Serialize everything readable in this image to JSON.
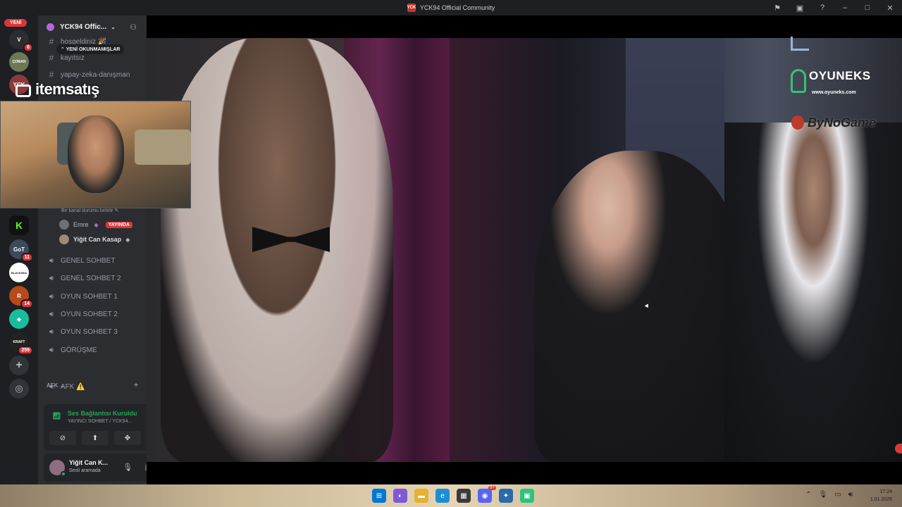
{
  "window": {
    "title": "YCK94 Official Community"
  },
  "server_rail": {
    "new_badge": "YENİ",
    "servers": [
      {
        "label": "V",
        "color": "#2b2d31",
        "badge": "6"
      },
      {
        "label": "ÇOMAN",
        "color": "#6b7a55",
        "badge": ""
      },
      {
        "label": "YCK",
        "color": "#8a3a3a",
        "badge": ""
      },
      {
        "label": "K",
        "color": "#53fc18",
        "badge": ""
      },
      {
        "label": "GoT",
        "color": "#3c4a5a",
        "badge": "11"
      },
      {
        "label": "BLACKSEA",
        "color": "#ffffff",
        "badge": ""
      },
      {
        "label": "R",
        "color": "#b54a1a",
        "badge": "14"
      },
      {
        "label": "◆",
        "color": "#1abc9c",
        "badge": ""
      },
      {
        "label": "KRAFT",
        "color": "#222222",
        "badge": "259"
      }
    ],
    "add_server": "+",
    "explore": "◎"
  },
  "guild": {
    "name": "YCK94 Offic...",
    "unread_pill": "YENİ OKUNMAMIŞLAR",
    "text_channels": [
      {
        "name": "hoşgeldiniz 🎉"
      },
      {
        "name": "kayıtsız"
      },
      {
        "name": "yapay-zeka-danışman"
      }
    ],
    "status_hint": "Bir kanal durumu belirle ✎",
    "voice_users": [
      {
        "name": "Emre",
        "live": "YAYINDA"
      },
      {
        "name": "Yiğit Can Kasap",
        "live": ""
      }
    ],
    "voice_channels": [
      {
        "name": "GENEL SOHBET"
      },
      {
        "name": "GENEL SOHBET 2"
      },
      {
        "name": "OYUN SOHBET 1"
      },
      {
        "name": "OYUN SOHBET 2"
      },
      {
        "name": "OYUN SOHBET 3"
      },
      {
        "name": "GÖRÜŞME"
      }
    ],
    "category_afk": "AFK",
    "afk_channel": "AFK ⚠️"
  },
  "voice_connection": {
    "status": "Ses Bağlantısı Kuruldu",
    "channel": "YAYINCI SOHBET / YCK94..."
  },
  "user": {
    "name": "Yiğit Can K...",
    "status": "Sesli aramada"
  },
  "stream": {
    "brand1": "OYUNEKS",
    "brand1_sub": "www.oyuneks.com",
    "brand2": "ByNoGame",
    "overlay_brand": "itemsatış"
  },
  "taskbar": {
    "time": "17:24",
    "date": "1.01.2026",
    "discord_badge": "9+"
  }
}
